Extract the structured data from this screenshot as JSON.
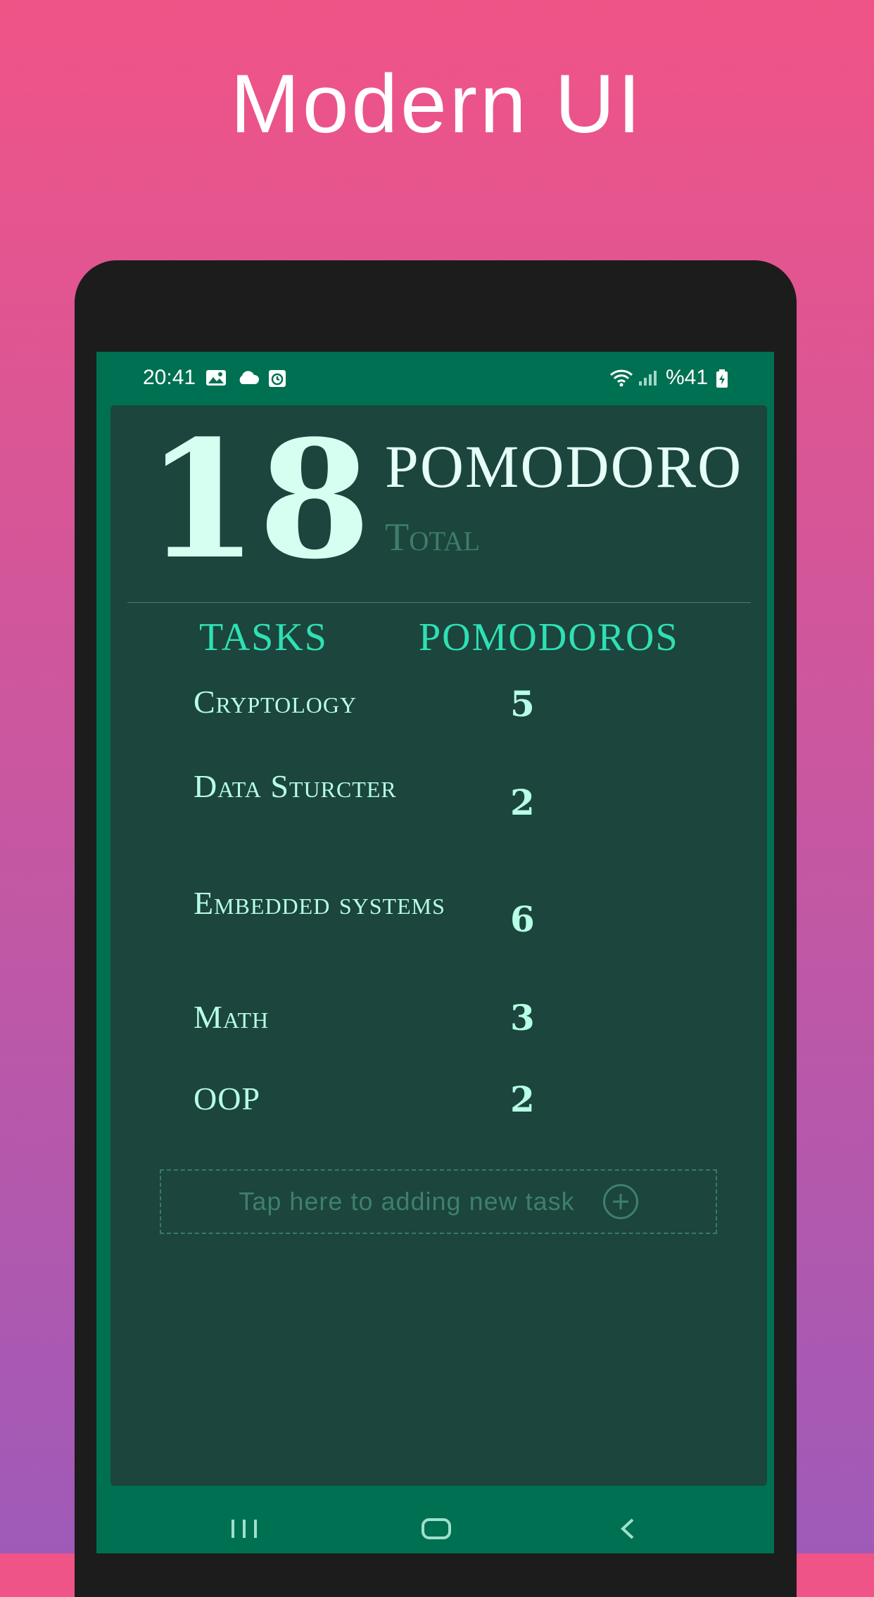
{
  "promo": {
    "title": "Modern UI"
  },
  "status_bar": {
    "time": "20:41",
    "battery": "%41",
    "left_icons": [
      "image-icon",
      "cloud-icon",
      "alarm-icon"
    ],
    "right_icons": [
      "wifi-icon",
      "signal-icon",
      "battery-charging-icon"
    ]
  },
  "summary": {
    "total": "18",
    "title": "POMODORO",
    "subtitle": "Total"
  },
  "table": {
    "headers": {
      "tasks": "TASKS",
      "pomodoros": "POMODOROS"
    },
    "rows": [
      {
        "task": "Cryptology",
        "count": "5"
      },
      {
        "task": "Data Sturcter",
        "count": "2"
      },
      {
        "task": "Embedded systems",
        "count": "6"
      },
      {
        "task": "Math",
        "count": "3"
      },
      {
        "task": "OOP",
        "count": "2"
      }
    ]
  },
  "add_task": {
    "label": "Tap here to adding new task",
    "icon": "add-circle-icon"
  },
  "nav": {
    "icons": [
      "recents-icon",
      "home-icon",
      "back-icon"
    ]
  },
  "colors": {
    "screen_bg": "#007052",
    "card_bg": "#1b453d",
    "accent": "#2fe0b4",
    "text_light": "#b7ffe6",
    "muted": "#3d7d6a"
  }
}
